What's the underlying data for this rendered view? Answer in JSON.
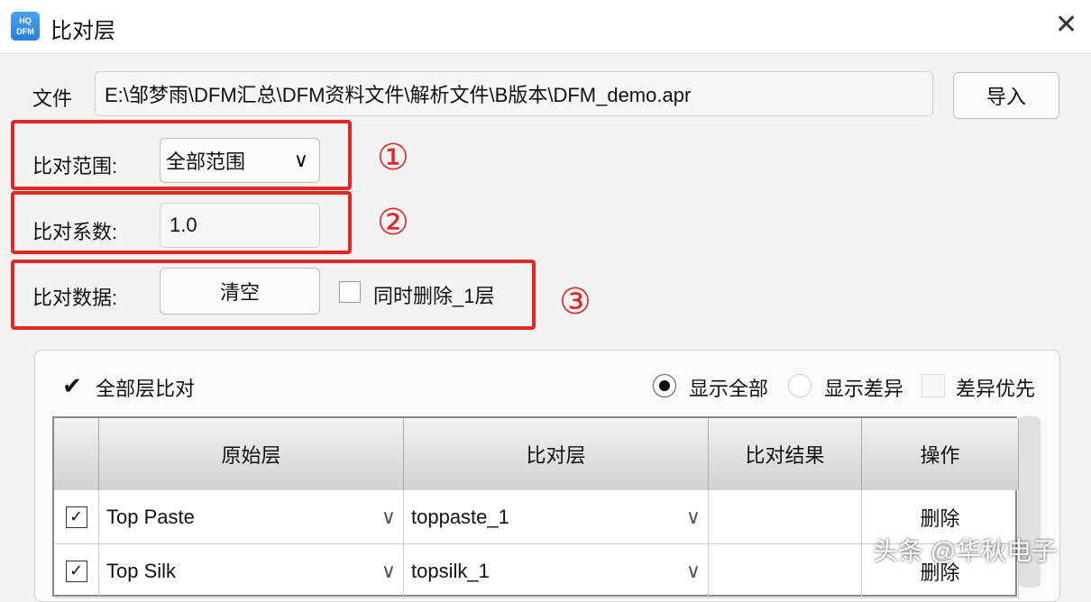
{
  "window": {
    "title": "比对层",
    "logo_text": "HQ DFM"
  },
  "file": {
    "label": "文件",
    "path": "E:\\邹梦雨\\DFM汇总\\DFM资料文件\\解析文件\\B版本\\DFM_demo.apr",
    "import_label": "导入"
  },
  "range": {
    "label": "比对范围:",
    "value": "全部范围"
  },
  "coef": {
    "label": "比对系数:",
    "value": "1.0"
  },
  "data": {
    "label": "比对数据:",
    "clear_label": "清空",
    "delete_layer_label": "同时删除_1层",
    "delete_layer_checked": false
  },
  "annotations": [
    "①",
    "②",
    "③"
  ],
  "annotation_color": "#e02828",
  "options": {
    "all_layers_label": "全部层比对",
    "all_layers_checked": true,
    "show_all": "显示全部",
    "show_diff": "显示差异",
    "diff_first": "差异优先",
    "selected": "显示全部"
  },
  "table": {
    "headers": [
      "原始层",
      "比对层",
      "比对结果",
      "操作"
    ],
    "rows": [
      {
        "checked": true,
        "original": "Top Paste",
        "compare": "toppaste_1",
        "result": "",
        "action": "删除"
      },
      {
        "checked": true,
        "original": "Top Silk",
        "compare": "topsilk_1",
        "result": "",
        "action": "删除"
      }
    ]
  },
  "watermark": "头条 @华秋电子"
}
